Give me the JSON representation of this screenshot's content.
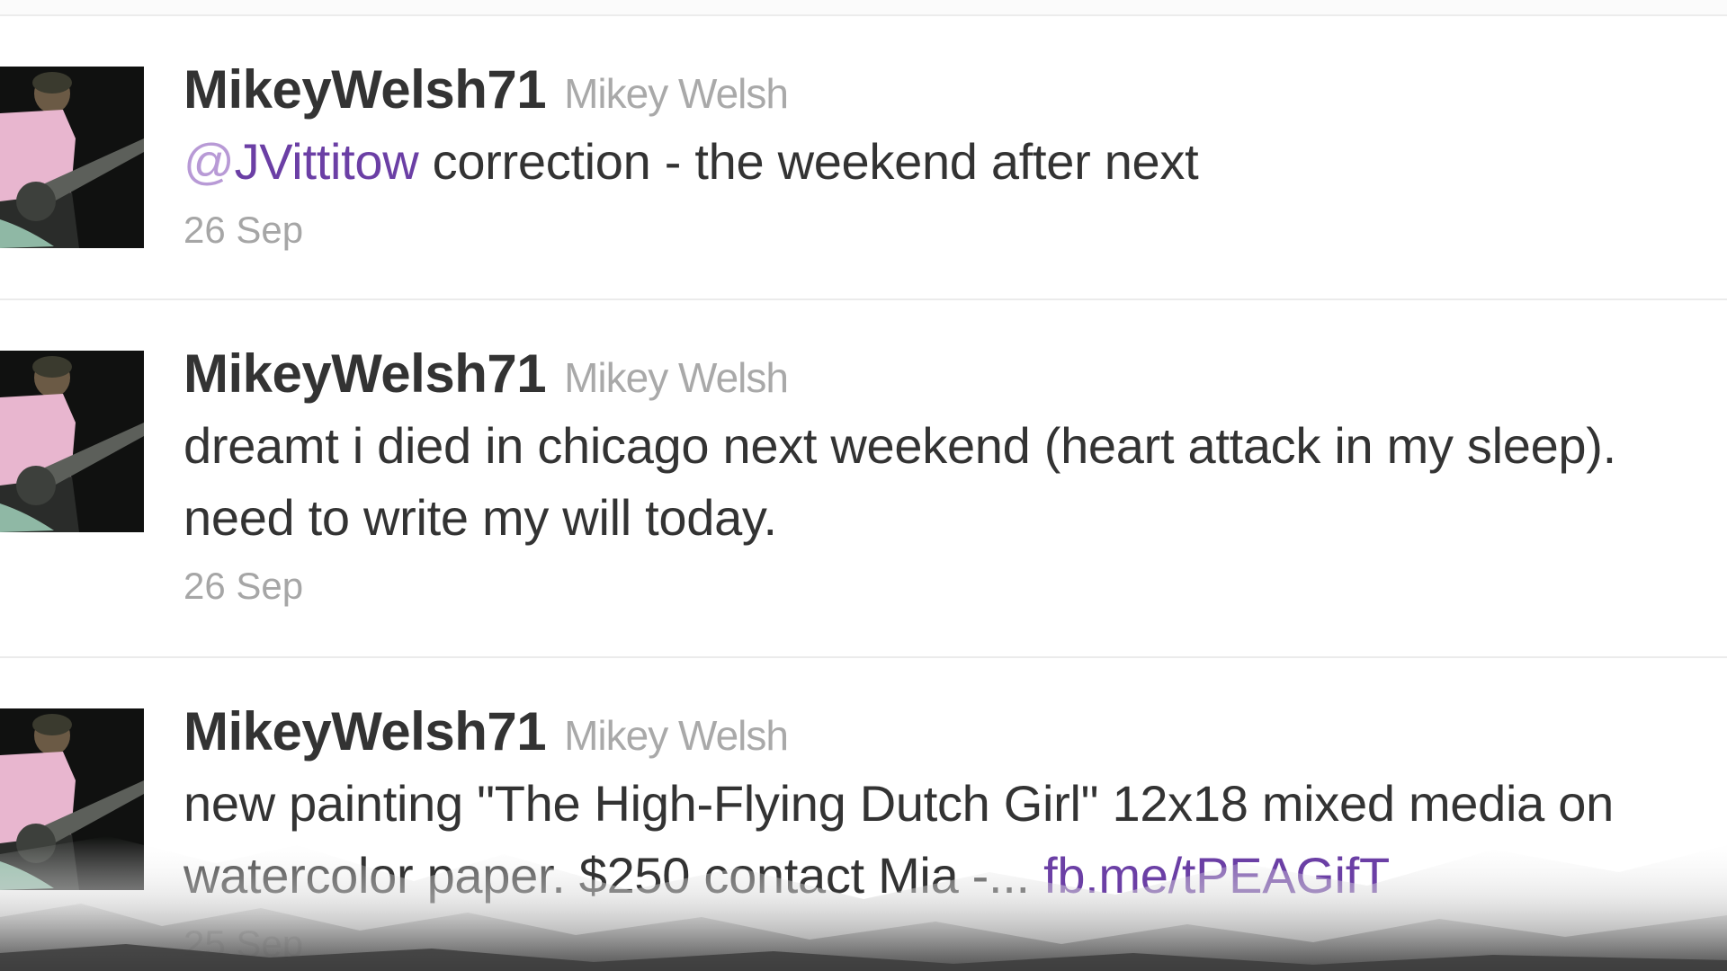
{
  "tweets": [
    {
      "username": "MikeyWelsh71",
      "fullname": "Mikey Welsh",
      "mention": "JVittitow",
      "mention_prefix": "@",
      "text": " correction - the weekend after next",
      "date": "26 Sep"
    },
    {
      "username": "MikeyWelsh71",
      "fullname": "Mikey Welsh",
      "line1": "dreamt i died in chicago next weekend (heart attack in my sleep).",
      "line2": "need to write my will today.",
      "date": "26 Sep"
    },
    {
      "username": "MikeyWelsh71",
      "fullname": "Mikey Welsh",
      "line1": "new painting \"The High-Flying Dutch Girl\" 12x18 mixed media on",
      "line2_text": "watercolor paper. $250 contact Mia -... ",
      "link": "fb.me/tPEAGifT",
      "date": "25 Sep"
    }
  ],
  "colors": {
    "username": "#333333",
    "fullname": "#a9a9a9",
    "link": "#6b3fa5",
    "date": "#a6a6a6"
  }
}
